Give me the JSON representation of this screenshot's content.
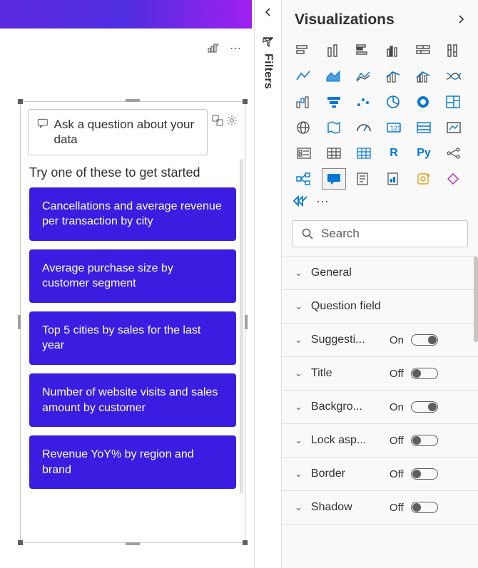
{
  "canvas": {
    "qna": {
      "placeholder": "Ask a question about your data",
      "heading": "Try one of these to get started",
      "suggestions": [
        "Cancellations and average revenue per transaction by city",
        "Average purchase size by customer segment",
        "Top 5 cities by sales for the last year",
        "Number of website visits and sales amount by customer",
        "Revenue YoY% by region and brand"
      ]
    }
  },
  "filters": {
    "label": "Filters"
  },
  "viz": {
    "title": "Visualizations",
    "search_placeholder": "Search",
    "gallery_icons": [
      "stacked-bar",
      "stacked-column",
      "clustered-bar",
      "clustered-column",
      "stacked-bar-100",
      "stacked-column-100",
      "line",
      "area",
      "stacked-area",
      "line-column",
      "line-column-clustered",
      "ribbon",
      "waterfall",
      "funnel",
      "scatter",
      "pie",
      "donut",
      "treemap",
      "map",
      "filled-map",
      "shape-map",
      "gauge",
      "card",
      "multi-row-card",
      "kpi",
      "slicer",
      "table",
      "matrix",
      "r-visual",
      "python-visual",
      "key-influencer",
      "decomposition-tree",
      "qna",
      "narrative",
      "paginated",
      "arcgis"
    ],
    "more_icon": "power-apps",
    "format": [
      {
        "label": "General",
        "state": "",
        "toggle": null
      },
      {
        "label": "Question field",
        "state": "",
        "toggle": null
      },
      {
        "label": "Suggesti...",
        "state": "On",
        "toggle": "on"
      },
      {
        "label": "Title",
        "state": "Off",
        "toggle": "off"
      },
      {
        "label": "Backgro...",
        "state": "On",
        "toggle": "on"
      },
      {
        "label": "Lock asp...",
        "state": "Off",
        "toggle": "off"
      },
      {
        "label": "Border",
        "state": "Off",
        "toggle": "off"
      },
      {
        "label": "Shadow",
        "state": "Off",
        "toggle": "off"
      }
    ]
  },
  "colors": {
    "accent": "#3a1de0",
    "blue": "#0078d4"
  }
}
